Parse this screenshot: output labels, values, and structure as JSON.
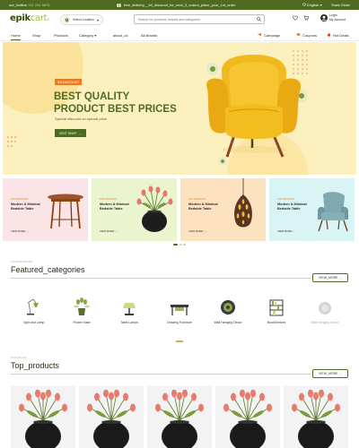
{
  "topbar": {
    "hotline_label": "our_hotline",
    "hotline_number": "+01 234 5678",
    "promo_text": "free_delivery__40_discount_for_next_3_orders_place_your_1st_order",
    "language": "English",
    "track_order": "Track Order"
  },
  "header": {
    "logo_main": "epik",
    "logo_accent": "cart",
    "location_label": "Select Location",
    "search_placeholder": "Search for products, brands and categories",
    "login_label": "Login",
    "account_label": "My Account"
  },
  "nav": {
    "items": [
      "Home",
      "Shop",
      "Products",
      "Category",
      "about_us",
      "All Brands"
    ],
    "right_items": [
      "Campaign",
      "Coupons",
      "Hot Deals"
    ]
  },
  "hero": {
    "tag": "5% DISCOUNT",
    "line1": "BEST QUALITY",
    "line2": "PRODUCT BEST PRICES",
    "subtitle": "Special discount on special price",
    "button": "VISIT SHOP"
  },
  "promo_cards": [
    {
      "tag": "15% DISCOUNT",
      "title": "Modern & Minimal Bedside Table",
      "view": "VIEW MORE",
      "bg": "#fbe4e6"
    },
    {
      "tag": "15% DISCOUNT",
      "title": "Modern & Minimal Bedside Table",
      "view": "VIEW MORE",
      "bg": "#eaf4cf"
    },
    {
      "tag": "15% DISCOUNT",
      "title": "Modern & Minimal Bedside Table",
      "view": "VIEW MORE",
      "bg": "#fde2bf"
    },
    {
      "tag": "15% DISCOUNT",
      "title": "Modern & Minimal Bedside Table",
      "view": "VIEW MORE",
      "bg": "#d9f4f5"
    }
  ],
  "featured": {
    "small": "CATEGORIES",
    "title": "Featured_categories",
    "view_more": "VIEW_MORE",
    "items": [
      "light and Lamp",
      "Flower Vase",
      "Table Lamps",
      "Drawing Furniture",
      "Wall Hanging Decor",
      "BookShelves",
      "Wall Hanging Decor"
    ]
  },
  "top_products": {
    "small": "POPULAR",
    "title": "Top_products",
    "view_more": "VIEW_MORE"
  },
  "colors": {
    "brand": "#4f6b22",
    "hero_bg": "#fdf0bf",
    "accent": "#e97b1d"
  }
}
